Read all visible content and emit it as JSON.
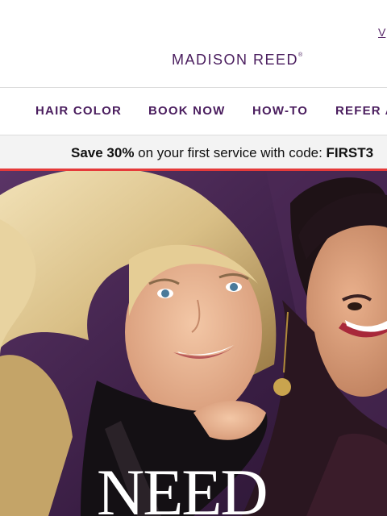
{
  "header": {
    "view_link": "V",
    "logo_text": "MADISON REED",
    "logo_mark": "®"
  },
  "nav": {
    "items": [
      {
        "label": "HAIR COLOR"
      },
      {
        "label": "BOOK NOW"
      },
      {
        "label": "HOW-TO"
      },
      {
        "label": "REFER A"
      }
    ]
  },
  "promo": {
    "lead": "Save 30%",
    "middle": " on your first service with code: ",
    "code": "FIRST3"
  },
  "hero": {
    "heading": "NEED"
  },
  "colors": {
    "brand": "#4a1d5e",
    "accent": "#e53a3a",
    "promo_bg": "#f3f3f3"
  }
}
